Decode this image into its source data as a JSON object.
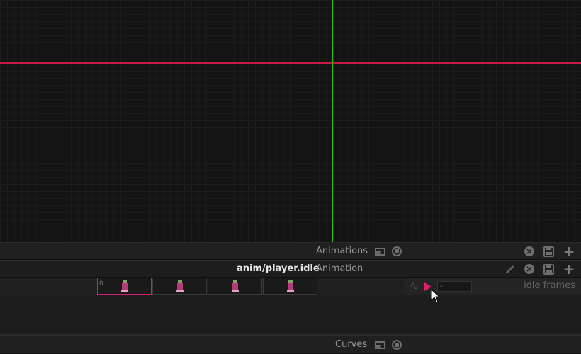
{
  "viewport": {
    "x_axis_color": "#c8174a",
    "y_axis_color": "#2fc21d"
  },
  "animations_panel": {
    "title": "Animations",
    "icons": [
      "panel-toggle-icon",
      "pause-icon",
      "close-icon",
      "save-icon",
      "add-icon"
    ]
  },
  "animation_bar": {
    "name": "anim/player.idle",
    "title": "Animation",
    "icons": [
      "pencil-icon",
      "close-icon",
      "save-icon",
      "add-icon"
    ]
  },
  "frame_strip": {
    "first_frame_number": "0",
    "frames": [
      "frame-0",
      "frame-1",
      "frame-2",
      "frame-3"
    ],
    "selected_index": 0,
    "selection_color": "#d91d6e"
  },
  "playback": {
    "frame_field_value": "-",
    "strip_name": "idle frames",
    "play_color": "#e0206f"
  },
  "curves_panel": {
    "title": "Curves"
  }
}
